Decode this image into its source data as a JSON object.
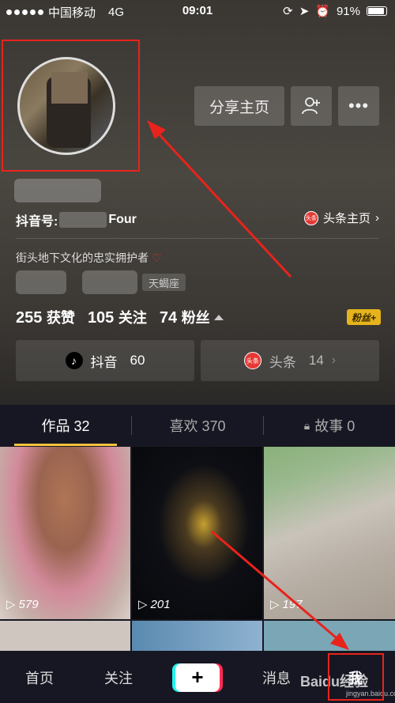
{
  "status_bar": {
    "carrier": "中国移动",
    "network": "4G",
    "time": "09:01",
    "battery": "91%"
  },
  "header": {
    "share_label": "分享主页",
    "douyin_id_label": "抖音号:",
    "douyin_id_suffix": "Four",
    "toutiao_home_label": "头条主页",
    "toutiao_badge": "头条",
    "bio": "街头地下文化的忠实拥护者",
    "zodiac": "天蝎座"
  },
  "stats": {
    "likes_value": "255",
    "likes_label": "获赞",
    "following_value": "105",
    "following_label": "关注",
    "fans_value": "74",
    "fans_label": "粉丝",
    "fans_badge": "粉丝+"
  },
  "platforms": {
    "douyin_label": "抖音",
    "douyin_count": "60",
    "toutiao_label": "头条",
    "toutiao_count": "14",
    "toutiao_badge": "头条"
  },
  "tabs": [
    {
      "label": "作品 32"
    },
    {
      "label": "喜欢 370"
    },
    {
      "label": "故事 0"
    }
  ],
  "videos": [
    {
      "plays": "579"
    },
    {
      "plays": "201"
    },
    {
      "plays": "197"
    }
  ],
  "bottom_nav": {
    "home": "首页",
    "follow": "关注",
    "plus": "+",
    "messages": "消息",
    "me": "我"
  },
  "watermark": {
    "brand": "Baidu经验",
    "url": "jingyan.baidu.com"
  },
  "colors": {
    "annotation_red": "#e8231c",
    "tab_underline": "#f6c23e",
    "background": "#161722"
  }
}
